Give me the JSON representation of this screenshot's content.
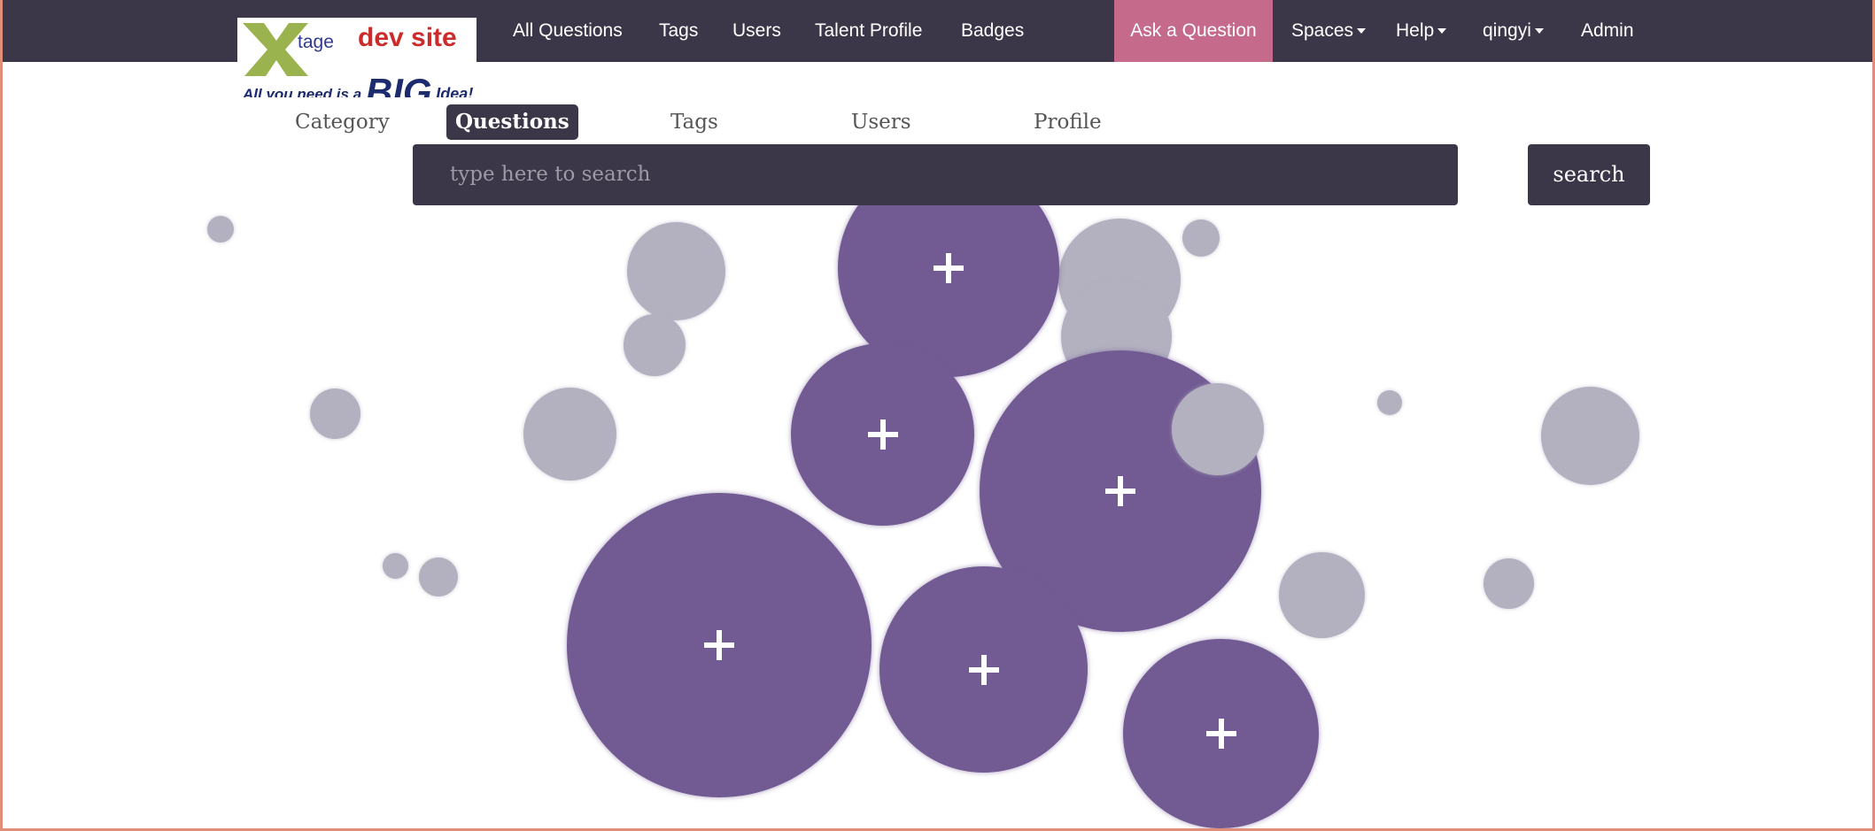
{
  "brand": {
    "logo_top_text": "tage",
    "logo_site_text": "dev site",
    "tagline_prefix": "All you need is a",
    "tagline_big": "BIG",
    "tagline_suffix": "Idea!"
  },
  "navbar": {
    "items": [
      {
        "label": "All Questions"
      },
      {
        "label": "Tags"
      },
      {
        "label": "Users"
      },
      {
        "label": "Talent Profile"
      },
      {
        "label": "Badges"
      }
    ],
    "ask_label": "Ask a Question",
    "dropdowns": [
      {
        "label": "Spaces"
      },
      {
        "label": "Help"
      },
      {
        "label": "qingyi"
      }
    ],
    "admin_label": "Admin",
    "colors": {
      "bar": "#3c3748",
      "ask": "#c56a8a"
    }
  },
  "search": {
    "filters": [
      {
        "label": "Category",
        "active": false
      },
      {
        "label": "Questions",
        "active": true
      },
      {
        "label": "Tags",
        "active": false
      },
      {
        "label": "Users",
        "active": false
      },
      {
        "label": "Profile",
        "active": false
      }
    ],
    "placeholder": "type here to search",
    "button_label": "search"
  },
  "bubbles": {
    "colors": {
      "active": "#725b93",
      "inactive": "#b3b0c0"
    },
    "expandable_icon": "plus-icon"
  }
}
